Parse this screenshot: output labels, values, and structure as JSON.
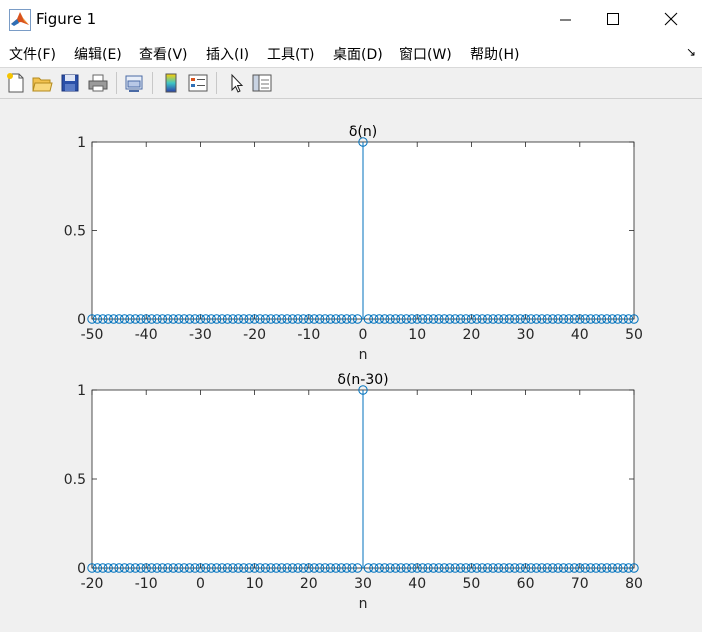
{
  "window": {
    "title": "Figure 1",
    "icon": "matlab-icon",
    "controls": [
      "minimize-icon",
      "maximize-icon",
      "close-icon"
    ]
  },
  "menu": {
    "items": [
      "文件(F)",
      "编辑(E)",
      "查看(V)",
      "插入(I)",
      "工具(T)",
      "桌面(D)",
      "窗口(W)",
      "帮助(H)"
    ],
    "overflow_icon": "dock-arrow-icon"
  },
  "toolbar": {
    "icons": [
      "new-figure-icon",
      "open-file-icon",
      "save-icon",
      "print-icon",
      "link-plot-icon",
      "colorbar-icon",
      "legend-icon",
      "edit-plot-pointer-icon",
      "property-inspector-icon"
    ]
  },
  "colors": {
    "stem": "#0072BD",
    "axes": "#262626"
  },
  "chart_data": [
    {
      "type": "stem",
      "title": "δ(n)",
      "xlabel": "n",
      "ylabel": "",
      "xlim": [
        -50,
        50
      ],
      "ylim": [
        0,
        1
      ],
      "xticks": [
        "-50",
        "-40",
        "-30",
        "-20",
        "-10",
        "0",
        "10",
        "20",
        "30",
        "40",
        "50"
      ],
      "yticks": [
        "0",
        "0.5",
        "1"
      ],
      "x_range": [
        -50,
        50
      ],
      "impulse_at": 0,
      "impulse_value": 1,
      "grid": false
    },
    {
      "type": "stem",
      "title": "δ(n-30)",
      "xlabel": "n",
      "ylabel": "",
      "xlim": [
        -20,
        80
      ],
      "ylim": [
        0,
        1
      ],
      "xticks": [
        "-20",
        "-10",
        "0",
        "10",
        "20",
        "30",
        "40",
        "50",
        "60",
        "70",
        "80"
      ],
      "yticks": [
        "0",
        "0.5",
        "1"
      ],
      "x_range": [
        -20,
        80
      ],
      "impulse_at": 30,
      "impulse_value": 1,
      "grid": false
    }
  ]
}
